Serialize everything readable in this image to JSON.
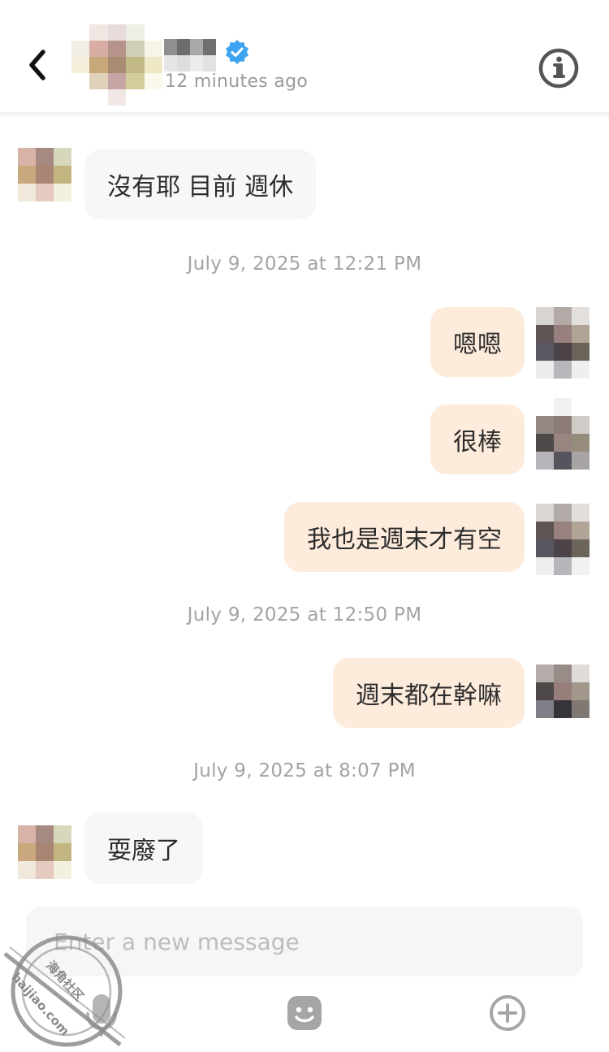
{
  "header": {
    "status": "12 minutes ago",
    "icons": {
      "back": "chevron-left-icon",
      "verified": "verified-check-icon",
      "info": "info-icon"
    },
    "colors": {
      "verified": "#3ea3f0",
      "info": "#555555"
    }
  },
  "messages": [
    {
      "type": "incoming",
      "text": "沒有耶 目前 週休"
    },
    {
      "type": "timestamp",
      "text": "July 9, 2025 at 12:21 PM"
    },
    {
      "type": "outgoing",
      "text": "嗯嗯"
    },
    {
      "type": "outgoing",
      "text": "很棒"
    },
    {
      "type": "outgoing",
      "text": "我也是週末才有空"
    },
    {
      "type": "timestamp",
      "text": "July 9, 2025 at 12:50 PM"
    },
    {
      "type": "outgoing",
      "text": "週末都在幹嘛"
    },
    {
      "type": "timestamp",
      "text": "July 9, 2025 at 8:07 PM"
    },
    {
      "type": "incoming",
      "text": "耍廢了"
    }
  ],
  "composer": {
    "placeholder": "Enter a new message",
    "icons": [
      "microphone-icon",
      "emoji-icon",
      "plus-icon"
    ]
  },
  "colors": {
    "incoming_bubble": "#f7f7f7",
    "outgoing_bubble": "#fdebdc",
    "timestamp_text": "#a3a3a3"
  },
  "watermark": {
    "text_latin": "haijiao.com",
    "text_cjk": "海角社区"
  }
}
